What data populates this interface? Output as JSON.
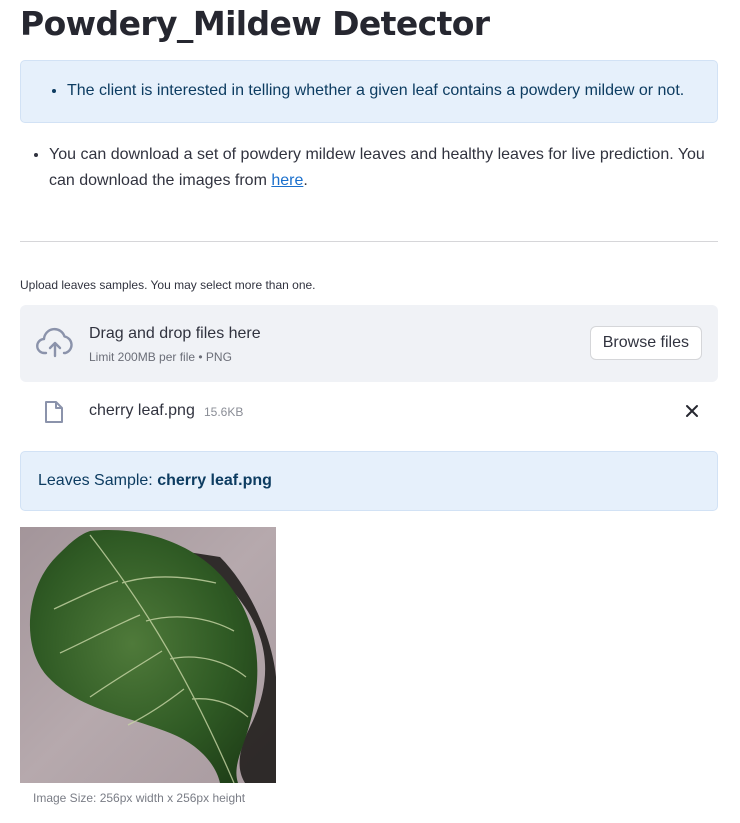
{
  "page": {
    "title": "Powdery_Mildew Detector"
  },
  "info_box": {
    "bullet": "The client is interested in telling whether a given leaf contains a powdery mildew or not."
  },
  "paragraph": {
    "text": "You can download a set of powdery mildew leaves and healthy leaves for live prediction. You can download the images from ",
    "link_text": "here",
    "suffix": "."
  },
  "uploader": {
    "label": "Upload leaves samples. You may select more than one.",
    "dropzone_title": "Drag and drop files here",
    "dropzone_subtitle": "Limit 200MB per file • PNG",
    "browse_label": "Browse files",
    "icon": "cloud-upload-icon"
  },
  "uploaded_file": {
    "name": "cherry leaf.png",
    "size": "15.6KB",
    "icon": "file-icon",
    "remove_icon": "close-icon"
  },
  "sample_box": {
    "prefix": "Leaves Sample: ",
    "filename": "cherry leaf.png"
  },
  "image": {
    "caption": "Image Size: 256px width x 256px height"
  },
  "colors": {
    "info_bg": "#e6f0fb",
    "info_text": "#0d3c61",
    "link": "#1a6fcc",
    "dropzone_bg": "#f0f2f6"
  }
}
